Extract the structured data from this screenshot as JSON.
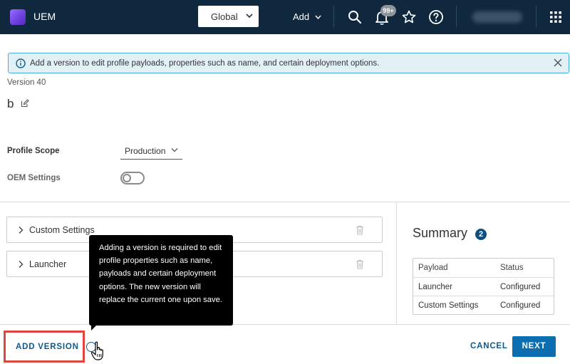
{
  "topbar": {
    "app_title": "UEM",
    "org_selector": "Global",
    "add_menu": "Add",
    "notification_badge": "99+",
    "colors": {
      "bar": "#10283d",
      "accent": "#0b6eb0"
    }
  },
  "alert": {
    "message": "Add a version to edit profile payloads, properties such as name, and certain deployment options."
  },
  "profile": {
    "version": "Version 40",
    "name": "b",
    "scope_label": "Profile Scope",
    "scope_value": "Production",
    "oem_label": "OEM Settings",
    "oem_enabled": false
  },
  "payloads": [
    {
      "name": "Custom Settings"
    },
    {
      "name": "Launcher"
    }
  ],
  "summary": {
    "title": "Summary",
    "count": "2",
    "headers": [
      "Payload",
      "Status"
    ],
    "rows": [
      [
        "Launcher",
        "Configured"
      ],
      [
        "Custom Settings",
        "Configured"
      ]
    ]
  },
  "tooltip": {
    "text": "Adding a version is required to edit profile properties such as name, payloads and certain deployment options. The new version will replace the current one upon save."
  },
  "footer": {
    "add_version": "ADD VERSION",
    "cancel": "CANCEL",
    "next": "NEXT"
  }
}
